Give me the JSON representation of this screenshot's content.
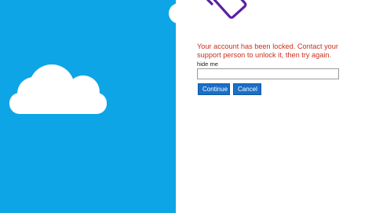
{
  "error": {
    "message": "Your account has been locked. Contact your support person to unlock it, then try again."
  },
  "form": {
    "field_label": "hide me",
    "field_value": "",
    "field_placeholder": ""
  },
  "buttons": {
    "continue_label": "Continue",
    "cancel_label": "Cancel"
  },
  "colors": {
    "sky": "#0ea5e6",
    "cloud": "#ffffff",
    "error": "#c8301e",
    "button": "#1a6fc7",
    "logo": "#5b1fa3"
  },
  "icons": {
    "logo": "phone-outline-logo",
    "clouds": "cloud-illustration"
  }
}
